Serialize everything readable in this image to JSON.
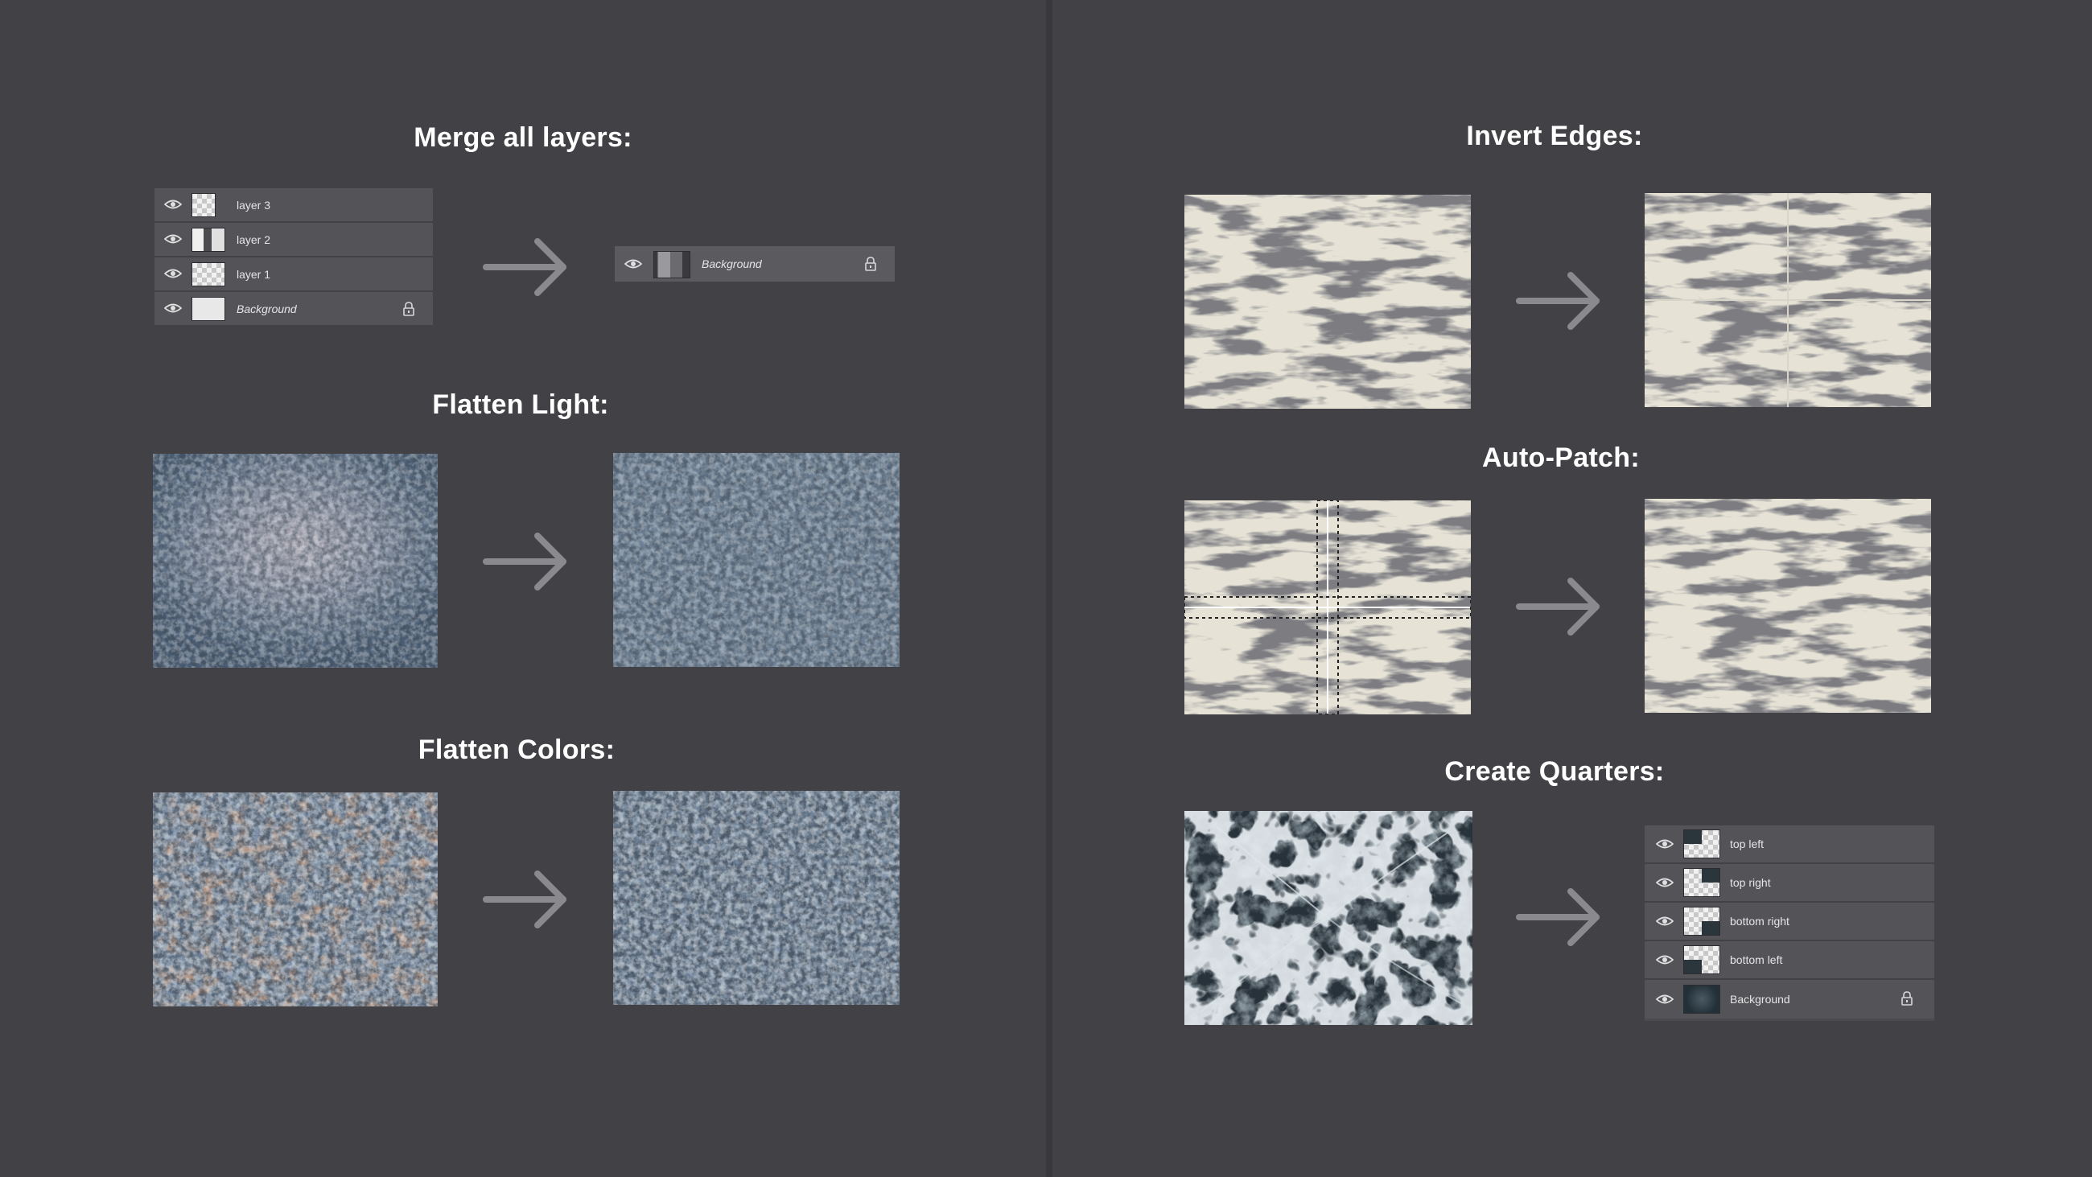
{
  "left": {
    "merge": {
      "title": "Merge all layers:",
      "layers": [
        "layer 3",
        "layer 2",
        "layer 1",
        "Background"
      ],
      "result_layer": "Background"
    },
    "flatten_light": {
      "title": "Flatten Light:"
    },
    "flatten_colors": {
      "title": "Flatten Colors:"
    }
  },
  "right": {
    "invert_edges": {
      "title": "Invert Edges:"
    },
    "auto_patch": {
      "title": "Auto-Patch:"
    },
    "create_quarters": {
      "title": "Create Quarters:",
      "layers": [
        "top left",
        "top right",
        "bottom right",
        "bottom left",
        "Background"
      ]
    }
  },
  "icons": [
    "eye-icon",
    "lock-icon",
    "arrow-right-icon"
  ],
  "colors": {
    "background": "#414146",
    "panel_row": "#535358",
    "arrow": "#8a8a8e"
  }
}
